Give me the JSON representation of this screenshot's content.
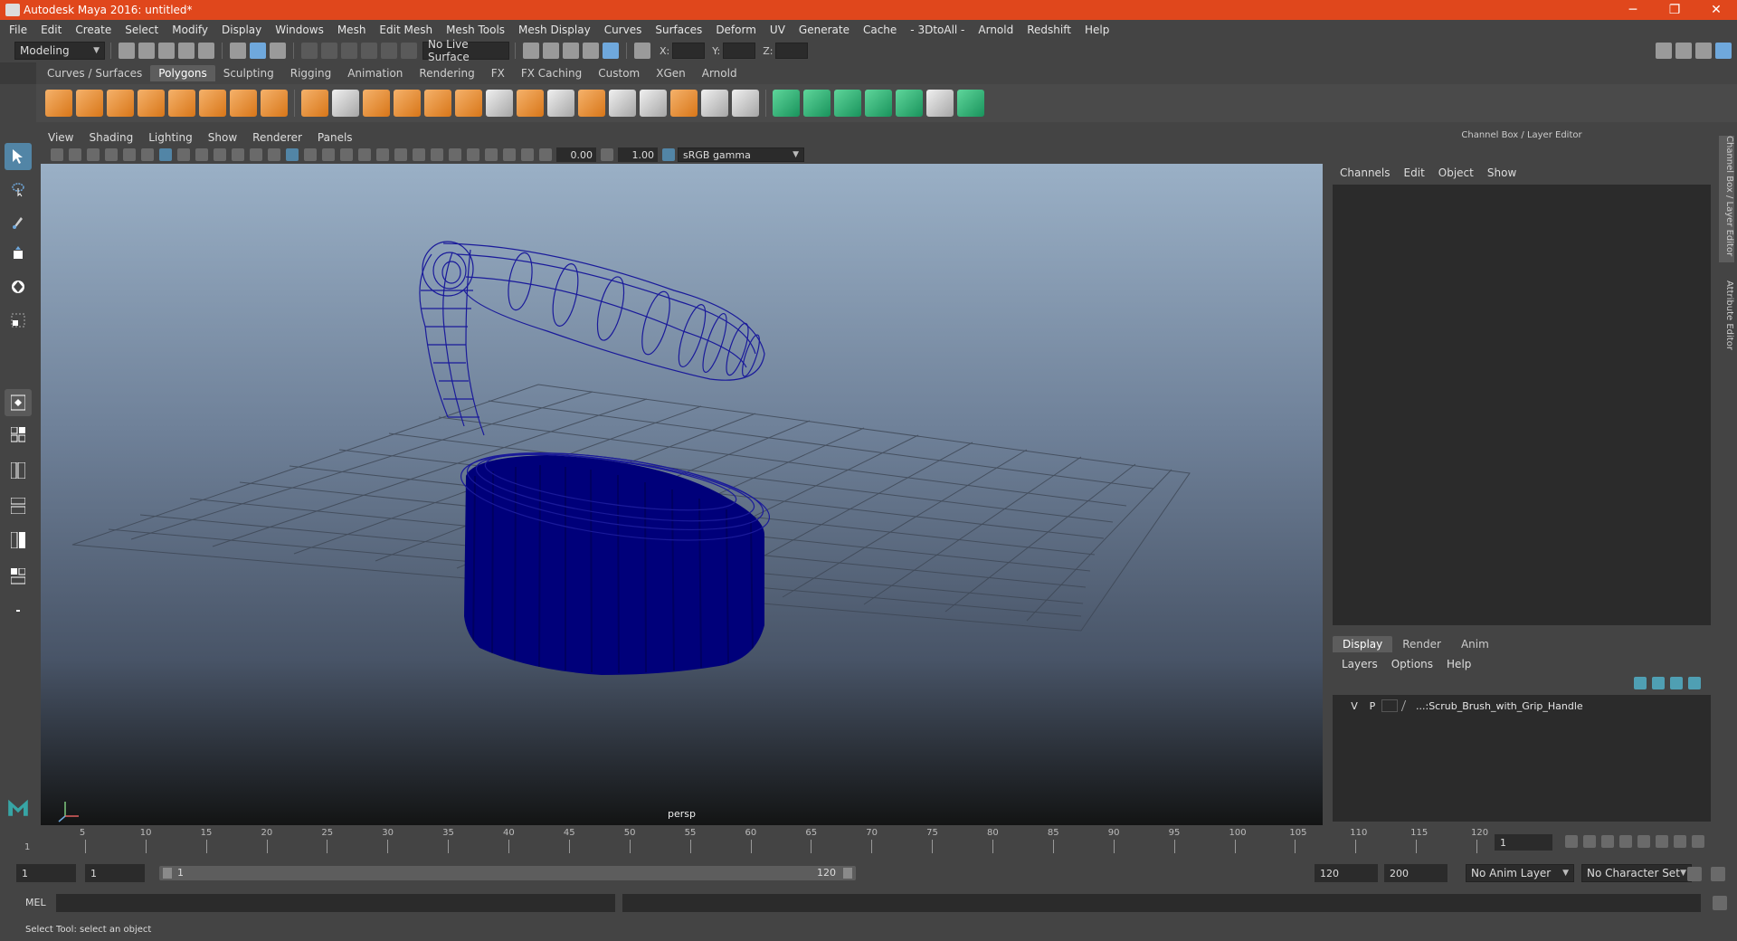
{
  "titlebar": {
    "title": "Autodesk Maya 2016: untitled*",
    "minimize": "─",
    "restore": "❐",
    "close": "✕"
  },
  "menubar": [
    "File",
    "Edit",
    "Create",
    "Select",
    "Modify",
    "Display",
    "Windows",
    "Mesh",
    "Edit Mesh",
    "Mesh Tools",
    "Mesh Display",
    "Curves",
    "Surfaces",
    "Deform",
    "UV",
    "Generate",
    "Cache",
    "- 3DtoAll -",
    "Arnold",
    "Redshift",
    "Help"
  ],
  "statusline": {
    "mode": "Modeling",
    "live_surface": "No Live Surface",
    "x_label": "X:",
    "y_label": "Y:",
    "z_label": "Z:"
  },
  "shelf_tabs": [
    "Curves / Surfaces",
    "Polygons",
    "Sculpting",
    "Rigging",
    "Animation",
    "Rendering",
    "FX",
    "FX Caching",
    "Custom",
    "XGen",
    "Arnold"
  ],
  "shelf_active_tab": "Polygons",
  "viewport": {
    "menu": [
      "View",
      "Shading",
      "Lighting",
      "Show",
      "Renderer",
      "Panels"
    ],
    "exposure": "0.00",
    "gamma": "1.00",
    "color_space": "sRGB gamma",
    "camera_label": "persp"
  },
  "channel_box": {
    "header": "Channel Box / Layer Editor",
    "menu": [
      "Channels",
      "Edit",
      "Object",
      "Show"
    ]
  },
  "layer_editor": {
    "tabs": [
      "Display",
      "Render",
      "Anim"
    ],
    "active_tab": "Display",
    "menu": [
      "Layers",
      "Options",
      "Help"
    ],
    "layer": {
      "v": "V",
      "p": "P",
      "name": "...:Scrub_Brush_with_Grip_Handle"
    }
  },
  "side_tabs": [
    "Channel Box / Layer Editor",
    "Attribute Editor"
  ],
  "timeline": {
    "ticks": [
      "5",
      "10",
      "15",
      "20",
      "25",
      "30",
      "35",
      "40",
      "45",
      "50",
      "55",
      "60",
      "65",
      "70",
      "75",
      "80",
      "85",
      "90",
      "95",
      "100",
      "105",
      "110",
      "115",
      "120"
    ],
    "start_marker": "1",
    "current_frame": "1"
  },
  "range": {
    "start": "1",
    "anim_start": "1",
    "slider_start": "1",
    "slider_end": "120",
    "anim_end": "120",
    "end": "200",
    "anim_layer": "No Anim Layer",
    "character_set": "No Character Set"
  },
  "command_line": {
    "label": "MEL"
  },
  "help_line": "Select Tool: select an object",
  "colors": {
    "title_bar": "#e0471c",
    "viewport_top": "#9ab0c6",
    "viewport_bottom": "#131414",
    "mesh": "#00007a",
    "wireframe": "#1a1a9a",
    "selected_tool": "#5285a6"
  }
}
